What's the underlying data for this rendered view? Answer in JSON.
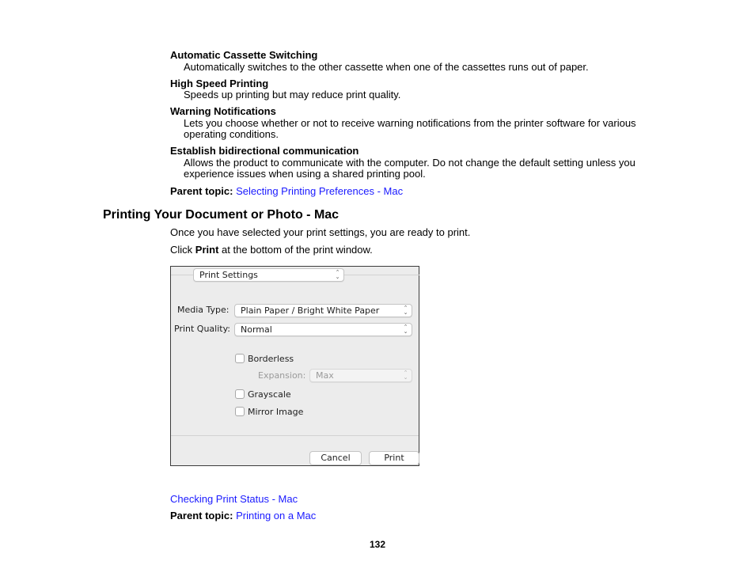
{
  "definitions": [
    {
      "term": "Automatic Cassette Switching",
      "description": "Automatically switches to the other cassette when one of the cassettes runs out of paper."
    },
    {
      "term": "High Speed Printing",
      "description": "Speeds up printing but may reduce print quality."
    },
    {
      "term": "Warning Notifications",
      "description": "Lets you choose whether or not to receive warning notifications from the printer software for various operating conditions."
    },
    {
      "term": "Establish bidirectional communication",
      "description": "Allows the product to communicate with the computer. Do not change the default setting unless you experience issues when using a shared printing pool."
    }
  ],
  "parent_topic_1": {
    "label": "Parent topic:",
    "link": "Selecting Printing Preferences - Mac"
  },
  "section": {
    "heading": "Printing Your Document or Photo - Mac",
    "intro": "Once you have selected your print settings, you are ready to print.",
    "step_prefix": "Click ",
    "step_bold": "Print",
    "step_suffix": " at the bottom of the print window."
  },
  "dialog": {
    "panel_select": "Print Settings",
    "media_type_label": "Media Type:",
    "media_type_value": "Plain Paper / Bright White Paper",
    "print_quality_label": "Print Quality:",
    "print_quality_value": "Normal",
    "borderless_label": "Borderless",
    "borderless_checked": false,
    "expansion_label": "Expansion:",
    "expansion_value": "Max",
    "grayscale_label": "Grayscale",
    "grayscale_checked": false,
    "mirror_label": "Mirror Image",
    "mirror_checked": false,
    "cancel_label": "Cancel",
    "print_label": "Print",
    "arrows_glyph": "⌃⌄"
  },
  "related_link": "Checking Print Status - Mac",
  "parent_topic_2": {
    "label": "Parent topic:",
    "link": "Printing on a Mac"
  },
  "page_number": "132",
  "colors": {
    "link": "#1a1aff"
  }
}
